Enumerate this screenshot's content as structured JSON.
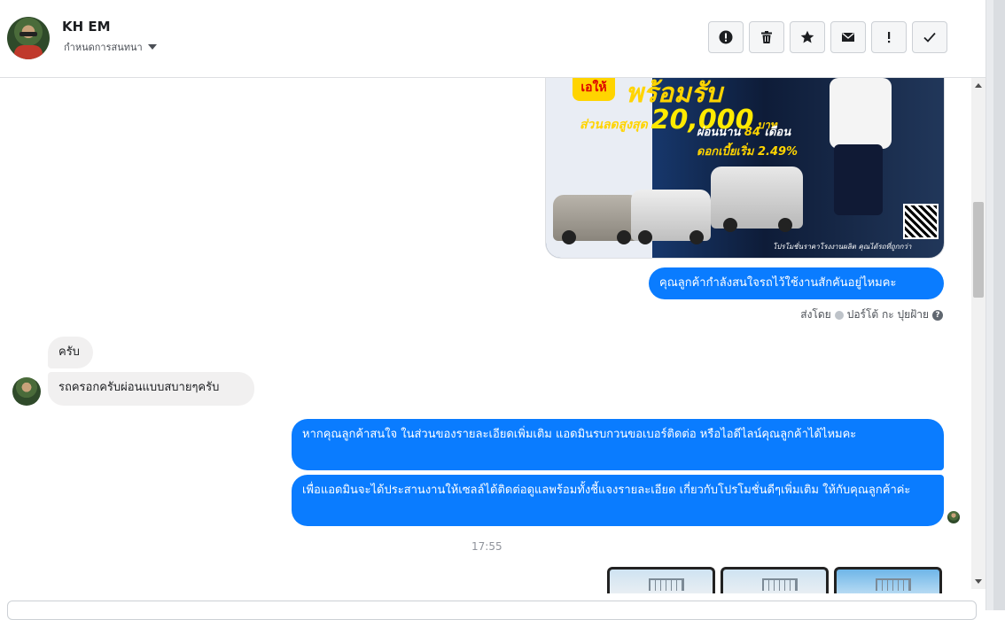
{
  "header": {
    "contact_name": "KH EM",
    "subtitle": "กำหนดการสนทนา"
  },
  "toolbar": {
    "buttons": [
      {
        "name": "report-button",
        "icon": "alert-circle-icon"
      },
      {
        "name": "delete-button",
        "icon": "trash-icon"
      },
      {
        "name": "star-button",
        "icon": "star-icon"
      },
      {
        "name": "mail-button",
        "icon": "mail-icon"
      },
      {
        "name": "flag-button",
        "icon": "exclamation-icon"
      },
      {
        "name": "done-button",
        "icon": "check-icon"
      }
    ]
  },
  "promo": {
    "burst": "เอให้",
    "headline": "พร้อมรับ",
    "line1_prefix": "ส่วนลดสูงสุด",
    "line1_amount": "20,000",
    "line1_unit": "บาท",
    "line2_prefix": "ผ่อนนาน",
    "line2_value": "84",
    "line2_suffix": "เดือน",
    "line3": "ดอกเบี้ยเริ่ม 2.49%",
    "footer": "โปรโมชั่นราคาโรงงานผลิต คุณได้รถที่ถูกกว่า"
  },
  "messages": {
    "out1": "คุณลูกค้ากำลังสนใจรถไว้ใช้งานสักคันอยู่ไหมคะ",
    "sent_by_label": "ส่งโดย",
    "sent_by_name": "ปอร์โต้ กะ ปุยฝ้าย",
    "in1": "ครับ",
    "in2": "รถครอกครับผ่อนแบบสบายๆครับ",
    "out2": "หากคุณลูกค้าสนใจ ในส่วนของรายละเอียดเพิ่มเติม แอดมินรบกวนขอเบอร์ติดต่อ หรือไอดีไลน์คุณลูกค้าได้ไหมคะ",
    "out3": "เพื่อแอดมินจะได้ประสานงานให้เซลล์ได้ติดต่อดูแลพร้อมทั้งชี้แจงรายละเอียด เกี่ยวกับโปรโมชั่นดีๆเพิ่มเติม ให้กับคุณลูกค้าค่ะ",
    "timestamp": "17:55"
  },
  "colors": {
    "outgoing_bubble": "#0a7cff",
    "incoming_bubble": "#f1f0f0",
    "promo_yellow": "#ffd400"
  }
}
